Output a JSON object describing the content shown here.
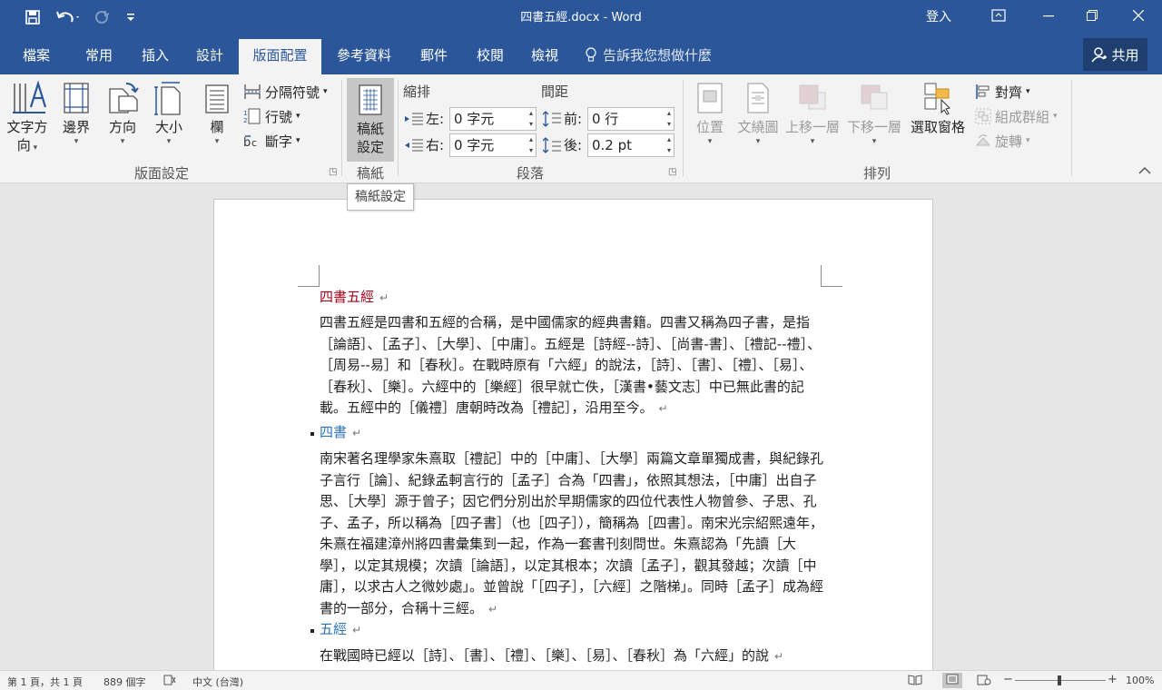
{
  "title_bar": {
    "doc_title": "四書五經.docx - Word",
    "signin": "登入",
    "qa_save": "save-icon",
    "qa_undo": "undo-icon",
    "qa_redo": "redo-icon",
    "qa_customize": "customize-icon"
  },
  "tabs": [
    "檔案",
    "常用",
    "插入",
    "設計",
    "版面配置",
    "參考資料",
    "郵件",
    "校閱",
    "檢視"
  ],
  "active_tab": "版面配置",
  "tell_me": "告訴我您想做什麼",
  "share": "共用",
  "ribbon": {
    "page_setup": {
      "text_direction_1": "文字方",
      "text_direction_2": "向",
      "margins": "邊界",
      "orientation": "方向",
      "size": "大小",
      "columns": "欄",
      "breaks": "分隔符號",
      "line_numbers": "行號",
      "hyphenation": "斷字",
      "label": "版面設定"
    },
    "manuscript": {
      "btn_1": "稿紙",
      "btn_2": "設定",
      "label": "稿紙"
    },
    "paragraph": {
      "indent": "縮排",
      "spacing": "間距",
      "left": "左:",
      "right": "右:",
      "before": "前:",
      "after": "後:",
      "left_value": "0 字元",
      "right_value": "0 字元",
      "before_value": "0 行",
      "after_value": "0.2 pt",
      "label": "段落"
    },
    "arrange": {
      "position": "位置",
      "wrap_text": "文繞圖",
      "bring_forward": "上移一層",
      "send_backward": "下移一層",
      "selection_pane": "選取窗格",
      "align": "對齊",
      "group": "組成群組",
      "rotate": "旋轉",
      "label": "排列"
    }
  },
  "tooltip": "稿紙設定",
  "document": {
    "title": "四書五經",
    "p1": "四書五經是四書和五經的合稱，是中國儒家的經典書籍。四書又稱為四子書，是指［論語］、［孟子］、［大學］、［中庸］。五經是［詩經--詩］、［尚書-書］、［禮記--禮］、［周易--易］和［春秋］。在戰時原有「六經」的說法，［詩］、［書］、［禮］、［易］、［春秋］、［樂］。六經中的［樂經］很早就亡佚，［漢書•藝文志］中已無此書的記載。五經中的［儀禮］唐朝時改為［禮記］，沿用至今。",
    "h2": "四書",
    "p2": "南宋著名理學家朱熹取［禮記］中的［中庸］、［大學］兩篇文章單獨成書，與紀錄孔子言行［論］、紀錄孟軻言行的［孟子］合為「四書」，依照其想法，［中庸］出自子思、［大學］源于曾子；因它們分別出於早期儒家的四位代表性人物曾參、子思、孔子、孟子，所以稱為［四子書］（也［四子］），簡稱為［四書］。南宋光宗紹熙遠年，朱熹在福建漳州將四書彙集到一起，作為一套書刊刻問世。朱熹認為「先讀［大學］，以定其規模；次讀［論語］，以定其根本；次讀［孟子］，觀其發越；次讀［中庸］，以求古人之微妙處」。並曾說「［四子］，［六經］之階梯」。同時［孟子］成為經書的一部分，合稱十三經。",
    "h3": "五經",
    "p3": "在戰國時已經以［詩］、［書］、［禮］、［樂］、［易］、［春秋］為「六經」的說"
  },
  "status": {
    "page": "第 1 頁，共 1 頁",
    "words": "889 個字",
    "language": "中文 (台灣)",
    "zoom": "100%",
    "zoom_level": 1.0
  },
  "colors": {
    "accent": "#2b579a",
    "heading_red": "#a3001a",
    "heading_blue": "#2e74b5"
  }
}
